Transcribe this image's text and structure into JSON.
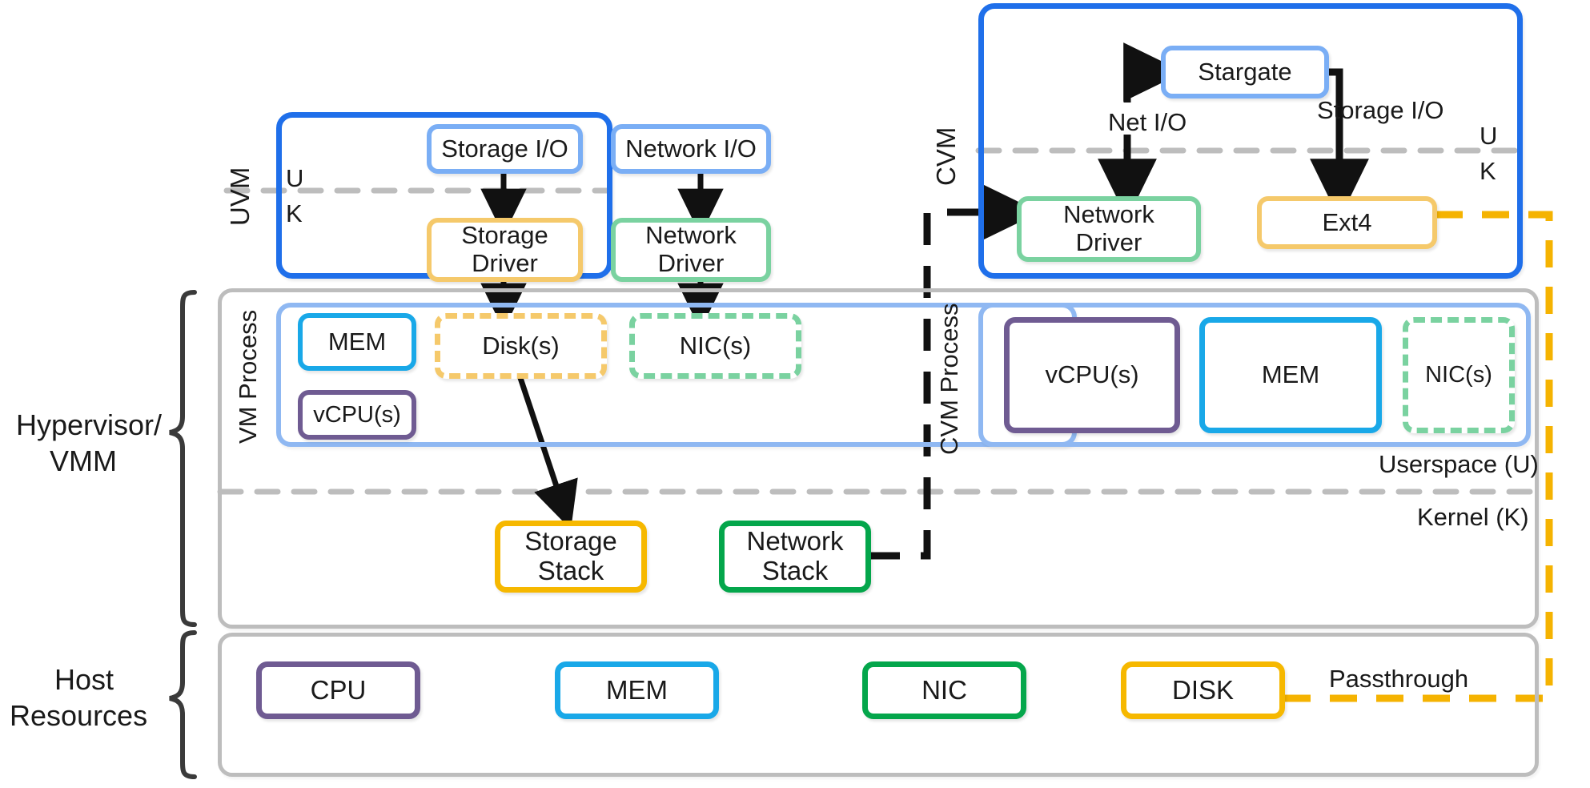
{
  "title": "Nutanix AHV I/O path diagram",
  "colors": {
    "uvm_border": "#1f6fea",
    "cvm_border": "#1f6fea",
    "light_blue": "#7aaef5",
    "sky_blue": "#19a8e8",
    "yellow": "#f5c242",
    "gold": "#f6b800",
    "green_light": "#7ad2a0",
    "green_dark": "#0aa košice",
    "green_stack": "#04a64b",
    "purple": "#6f5b92",
    "gray": "#b9b9b9",
    "dash_gray": "#bdbdbd",
    "black": "#111111",
    "orange_dash": "#f5b301"
  },
  "brackets": [
    {
      "label_line1": "Hypervisor/",
      "label_line2": "VMM"
    },
    {
      "label_line1": "Host",
      "label_line2": "Resources"
    }
  ],
  "uvm": {
    "label": "UVM",
    "boundary_upper": "U",
    "boundary_lower": "K",
    "nodes": [
      {
        "name": "storage-io",
        "label": "Storage I/O"
      },
      {
        "name": "network-io",
        "label": "Network I/O"
      },
      {
        "name": "storage-driver",
        "label_line1": "Storage",
        "label_line2": "Driver"
      },
      {
        "name": "network-driver",
        "label_line1": "Network",
        "label_line2": "Driver"
      }
    ]
  },
  "cvm": {
    "label": "CVM",
    "boundary_upper": "U",
    "boundary_lower": "K",
    "nodes": [
      {
        "name": "stargate",
        "label": "Stargate"
      },
      {
        "name": "network-driver",
        "label_line1": "Network",
        "label_line2": "Driver"
      },
      {
        "name": "ext4",
        "label": "Ext4"
      }
    ],
    "edge_labels": [
      {
        "name": "net-io",
        "label": "Net I/O"
      },
      {
        "name": "storage-io",
        "label": "Storage I/O"
      }
    ]
  },
  "hypervisor": {
    "userspace_label": "Userspace (U)",
    "kernel_label": "Kernel (K)",
    "vm_process": {
      "label": "VM Process",
      "nodes": [
        {
          "name": "mem",
          "label": "MEM"
        },
        {
          "name": "vcpus",
          "label": "vCPU(s)"
        },
        {
          "name": "disks",
          "label": "Disk(s)"
        },
        {
          "name": "nics",
          "label": "NIC(s)"
        }
      ]
    },
    "cvm_process": {
      "label": "CVM Process",
      "nodes": [
        {
          "name": "vcpus",
          "label": "vCPU(s)"
        },
        {
          "name": "mem",
          "label": "MEM"
        },
        {
          "name": "nics",
          "label": "NIC(s)"
        }
      ]
    },
    "kernel_nodes": [
      {
        "name": "storage-stack",
        "label_line1": "Storage",
        "label_line2": "Stack"
      },
      {
        "name": "network-stack",
        "label_line1": "Network",
        "label_line2": "Stack"
      }
    ]
  },
  "host_resources": {
    "nodes": [
      {
        "name": "cpu",
        "label": "CPU"
      },
      {
        "name": "mem",
        "label": "MEM"
      },
      {
        "name": "nic",
        "label": "NIC"
      },
      {
        "name": "disk",
        "label": "DISK"
      }
    ],
    "passthrough_label": "Passthrough"
  }
}
